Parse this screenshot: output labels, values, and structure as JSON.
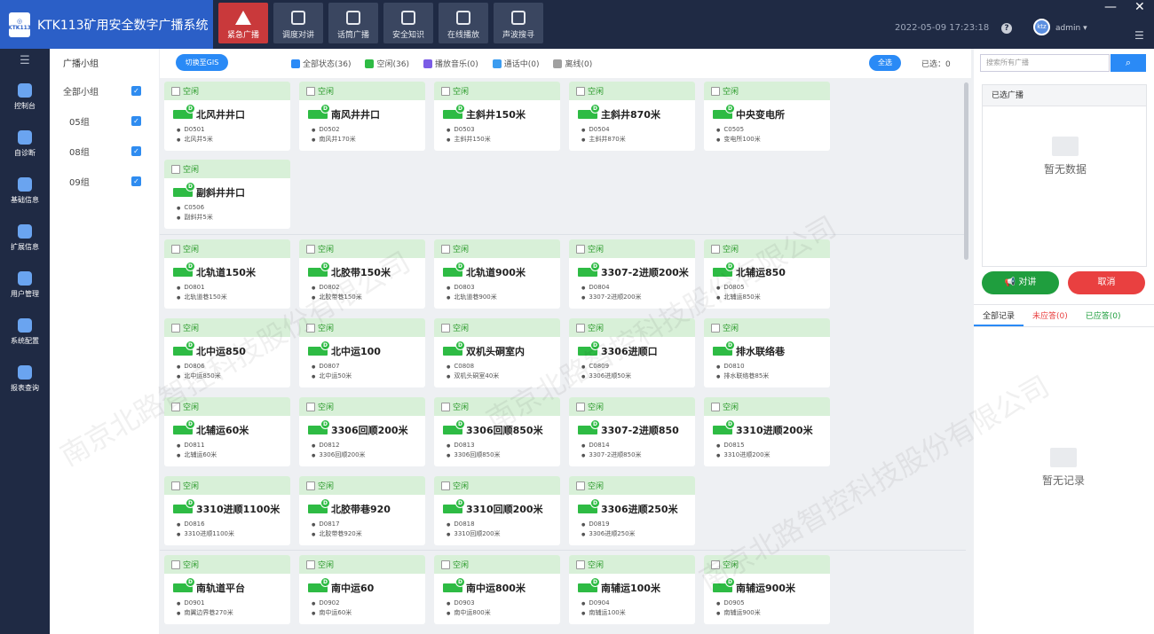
{
  "app": {
    "title": "KTK113矿用安全数字广播系统",
    "logo_text": "KTK113"
  },
  "top_menu": [
    {
      "label": "紧急广播",
      "active": true
    },
    {
      "label": "调度对讲",
      "active": false
    },
    {
      "label": "话筒广播",
      "active": false
    },
    {
      "label": "安全知识",
      "active": false
    },
    {
      "label": "在线播放",
      "active": false
    },
    {
      "label": "声波搜寻",
      "active": false
    }
  ],
  "header": {
    "datetime": "2022-05-09 17:23:18",
    "user": "admin",
    "help": "?",
    "avatar": "ktz"
  },
  "sidebar": [
    {
      "label": "控制台"
    },
    {
      "label": "自诊断"
    },
    {
      "label": "基础信息"
    },
    {
      "label": "扩展信息"
    },
    {
      "label": "用户管理"
    },
    {
      "label": "系统配置"
    },
    {
      "label": "报表查询"
    }
  ],
  "groups": {
    "title": "广播小组",
    "items": [
      {
        "label": "全部小组",
        "checked": true
      },
      {
        "label": "05组",
        "checked": true
      },
      {
        "label": "08组",
        "checked": true
      },
      {
        "label": "09组",
        "checked": true
      }
    ]
  },
  "toolbar": {
    "gis_button": "切换至GIS",
    "filters": [
      {
        "label": "全部状态(36)",
        "color": "#2a8af6"
      },
      {
        "label": "空闲(36)",
        "color": "#2ebb44"
      },
      {
        "label": "播放音乐(0)",
        "color": "#7b5ce6"
      },
      {
        "label": "通话中(0)",
        "color": "#3b9cf0"
      },
      {
        "label": "离线(0)",
        "color": "#a0a0a0"
      }
    ],
    "select_all": "全选",
    "selected": "已选：0"
  },
  "cards": [
    {
      "status": "空闲",
      "name": "北风井井口",
      "code": "D0501",
      "loc": "北风井5米"
    },
    {
      "status": "空闲",
      "name": "南风井井口",
      "code": "D0502",
      "loc": "南风井170米"
    },
    {
      "status": "空闲",
      "name": "主斜井150米",
      "code": "D0503",
      "loc": "主斜井150米"
    },
    {
      "status": "空闲",
      "name": "主斜井870米",
      "code": "D0504",
      "loc": "主斜井870米"
    },
    {
      "status": "空闲",
      "name": "中央变电所",
      "code": "C0505",
      "loc": "变电所100米"
    },
    {
      "status": "空闲",
      "name": "副斜井井口",
      "code": "C0506",
      "loc": "副斜井5米"
    },
    {
      "status": "空闲",
      "name": "北轨道150米",
      "code": "D0801",
      "loc": "北轨道巷150米"
    },
    {
      "status": "空闲",
      "name": "北胶带150米",
      "code": "D0802",
      "loc": "北胶带巷150米"
    },
    {
      "status": "空闲",
      "name": "北轨道900米",
      "code": "D0803",
      "loc": "北轨道巷900米"
    },
    {
      "status": "空闲",
      "name": "3307-2进顺200米",
      "code": "D0804",
      "loc": "3307-2进顺200米"
    },
    {
      "status": "空闲",
      "name": "北辅运850",
      "code": "D0805",
      "loc": "北辅运850米"
    },
    {
      "status": "空闲",
      "name": "北中运850",
      "code": "D0806",
      "loc": "北中运850米"
    },
    {
      "status": "空闲",
      "name": "北中运100",
      "code": "D0807",
      "loc": "北中运50米"
    },
    {
      "status": "空闲",
      "name": "双机头硐室内",
      "code": "C0808",
      "loc": "双机头硐室40米"
    },
    {
      "status": "空闲",
      "name": "3306进顺口",
      "code": "C0809",
      "loc": "3306进顺50米"
    },
    {
      "status": "空闲",
      "name": "排水联络巷",
      "code": "D0810",
      "loc": "排水联络巷85米"
    },
    {
      "status": "空闲",
      "name": "北辅运60米",
      "code": "D0811",
      "loc": "北辅运60米"
    },
    {
      "status": "空闲",
      "name": "3306回顺200米",
      "code": "D0812",
      "loc": "3306回顺200米"
    },
    {
      "status": "空闲",
      "name": "3306回顺850米",
      "code": "D0813",
      "loc": "3306回顺850米"
    },
    {
      "status": "空闲",
      "name": "3307-2进顺850",
      "code": "D0814",
      "loc": "3307-2进顺850米"
    },
    {
      "status": "空闲",
      "name": "3310进顺200米",
      "code": "D0815",
      "loc": "3310进顺200米"
    },
    {
      "status": "空闲",
      "name": "3310进顺1100米",
      "code": "D0816",
      "loc": "3310进顺1100米"
    },
    {
      "status": "空闲",
      "name": "北胶带巷920",
      "code": "D0817",
      "loc": "北胶带巷920米"
    },
    {
      "status": "空闲",
      "name": "3310回顺200米",
      "code": "D0818",
      "loc": "3310回顺200米"
    },
    {
      "status": "空闲",
      "name": "3306进顺250米",
      "code": "D0819",
      "loc": "3306进顺250米"
    },
    {
      "status": "空闲",
      "name": "南轨道平台",
      "code": "D0901",
      "loc": "南翼边界巷270米"
    },
    {
      "status": "空闲",
      "name": "南中运60",
      "code": "D0902",
      "loc": "南中运60米"
    },
    {
      "status": "空闲",
      "name": "南中运800米",
      "code": "D0903",
      "loc": "南中运800米"
    },
    {
      "status": "空闲",
      "name": "南辅运100米",
      "code": "D0904",
      "loc": "南辅运100米"
    },
    {
      "status": "空闲",
      "name": "南辅运900米",
      "code": "D0905",
      "loc": "南辅运900米"
    }
  ],
  "right": {
    "search_placeholder": "搜索所有广播",
    "selected_title": "已选广播",
    "empty_data": "暂无数据",
    "talk": "对讲",
    "cancel": "取消",
    "tabs": [
      "全部记录",
      "未应答(0)",
      "已应答(0)"
    ],
    "empty_records": "暂无记录"
  },
  "watermark": "南京北路智控科技股份有限公司"
}
